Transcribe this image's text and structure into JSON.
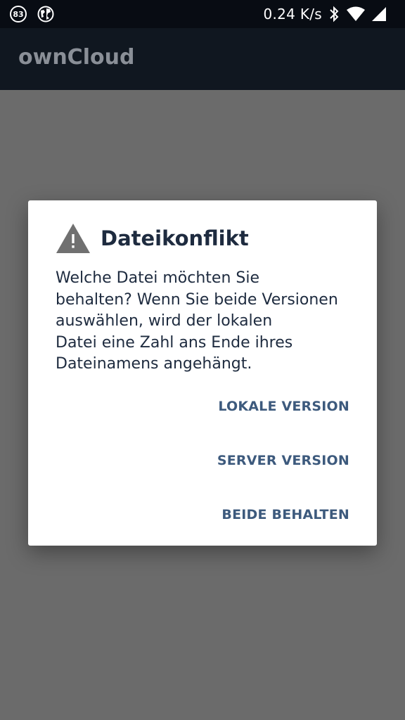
{
  "status_bar": {
    "notification_count": "83",
    "network_speed": "0.24 K/s",
    "icons": [
      "notification-badge",
      "globe-icon",
      "bluetooth-icon",
      "wifi-icon",
      "signal-icon"
    ]
  },
  "app_bar": {
    "title": "ownCloud"
  },
  "dialog": {
    "icon": "warning-icon",
    "title": "Dateikonflikt",
    "message": "Welche Datei möchten Sie\nbehalten? Wenn Sie beide Versionen\nauswählen, wird der lokalen\nDatei eine Zahl ans Ende ihres\nDateinamens angehängt.",
    "actions": [
      {
        "label": "LOKALE VERSION"
      },
      {
        "label": "SERVER VERSION"
      },
      {
        "label": "BEIDE BEHALTEN"
      }
    ]
  },
  "colors": {
    "status_bar_bg": "#080c13",
    "app_bar_bg": "#101720",
    "scrim": "#6b6b6b",
    "dialog_bg": "#ffffff",
    "title_text": "#1e2b3f",
    "action_text": "#3d5a7d",
    "warning_icon": "#707070"
  }
}
